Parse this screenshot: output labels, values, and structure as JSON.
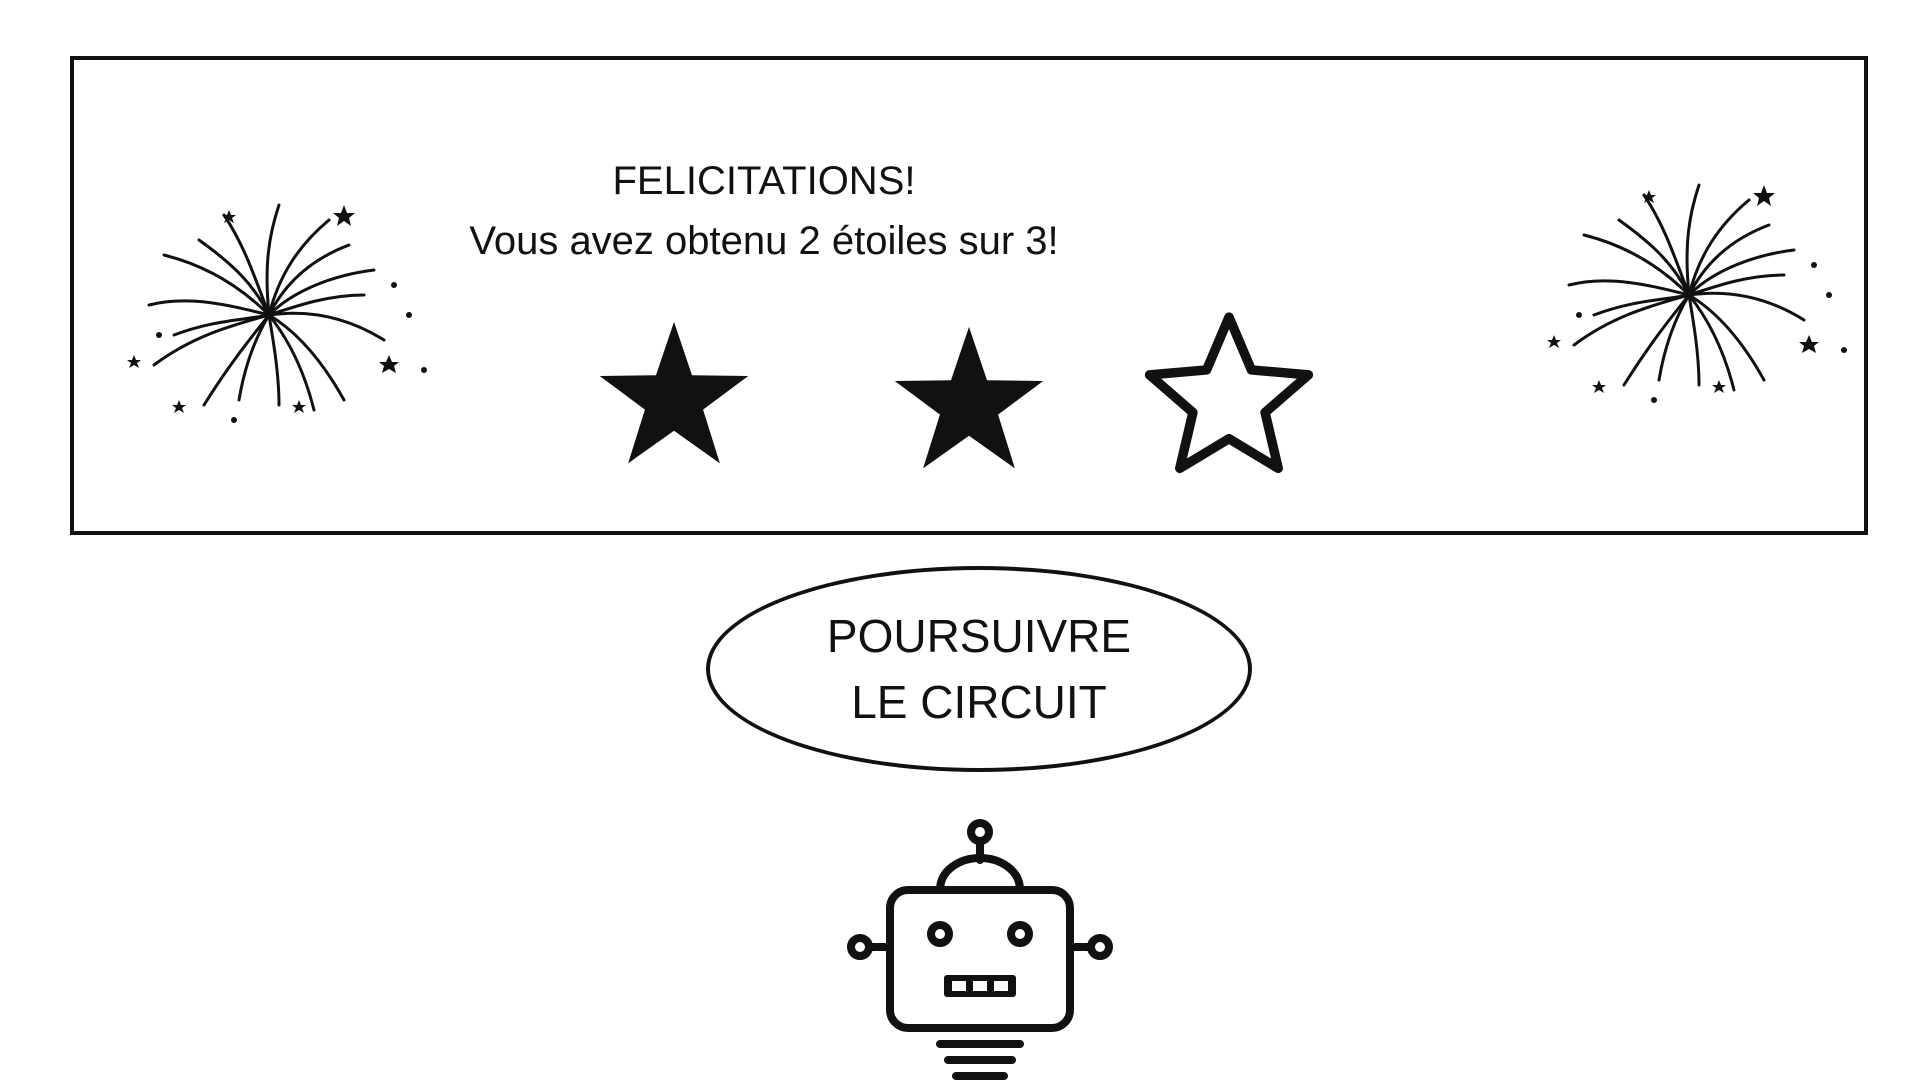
{
  "banner": {
    "title": "FELICITATIONS!",
    "subtitle": "Vous avez obtenu 2 étoiles sur 3!",
    "rating": {
      "earned": 2,
      "total": 3
    }
  },
  "actions": {
    "continue_label": "POURSUIVRE\nLE CIRCUIT"
  },
  "icons": {
    "decoration_left": "firework-icon",
    "decoration_right": "firework-icon",
    "star_filled": "star-filled-icon",
    "star_empty": "star-outline-icon",
    "mascot": "robot-icon"
  },
  "colors": {
    "ink": "#111111",
    "background": "#ffffff"
  }
}
